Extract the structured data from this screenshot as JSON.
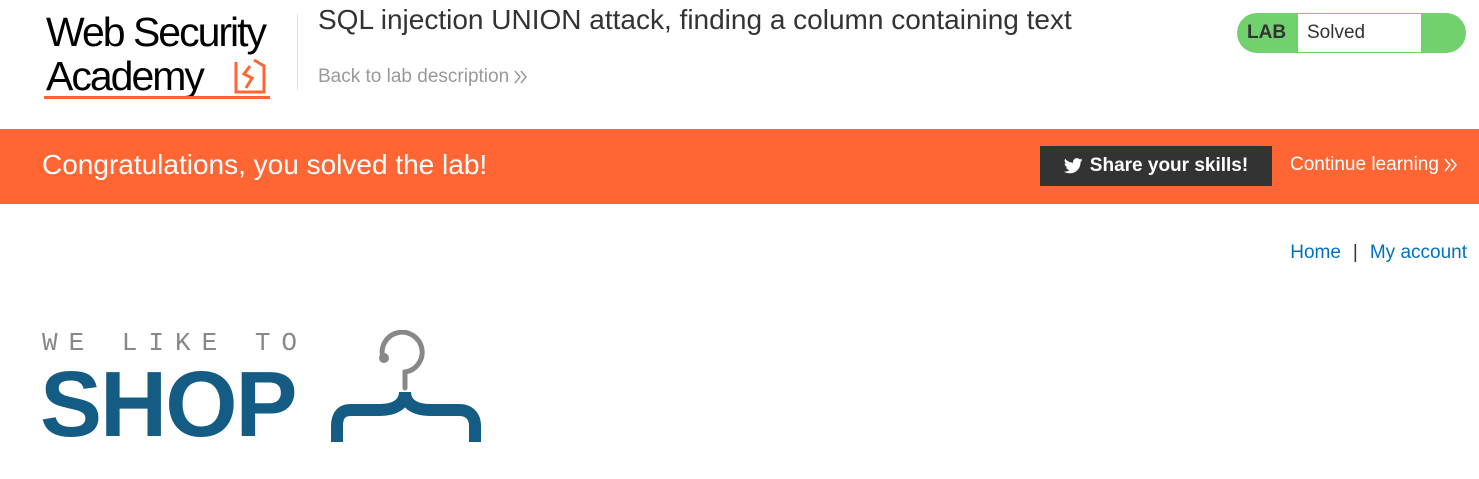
{
  "academy": {
    "logo_line1": "Web Security",
    "logo_line2": "Academy",
    "logo_icon": "academy-lightning-icon",
    "lab_title": "SQL injection UNION attack, finding a column containing text",
    "back_link": "Back to lab description",
    "lab_label": "LAB",
    "lab_status": "Solved",
    "status_color": "#70d16d"
  },
  "banner": {
    "message": "Congratulations, you solved the lab!",
    "share_button": "Share your skills!",
    "share_icon": "twitter-icon",
    "continue_link": "Continue learning",
    "background_color": "#ff6633"
  },
  "nav": {
    "home": "Home",
    "separator": "|",
    "my_account": "My account",
    "link_color": "#0071bc"
  },
  "shop_logo": {
    "tagline": "WE LIKE TO",
    "word": "SHOP",
    "icon": "hanger-icon",
    "brand_color": "#155c84"
  }
}
